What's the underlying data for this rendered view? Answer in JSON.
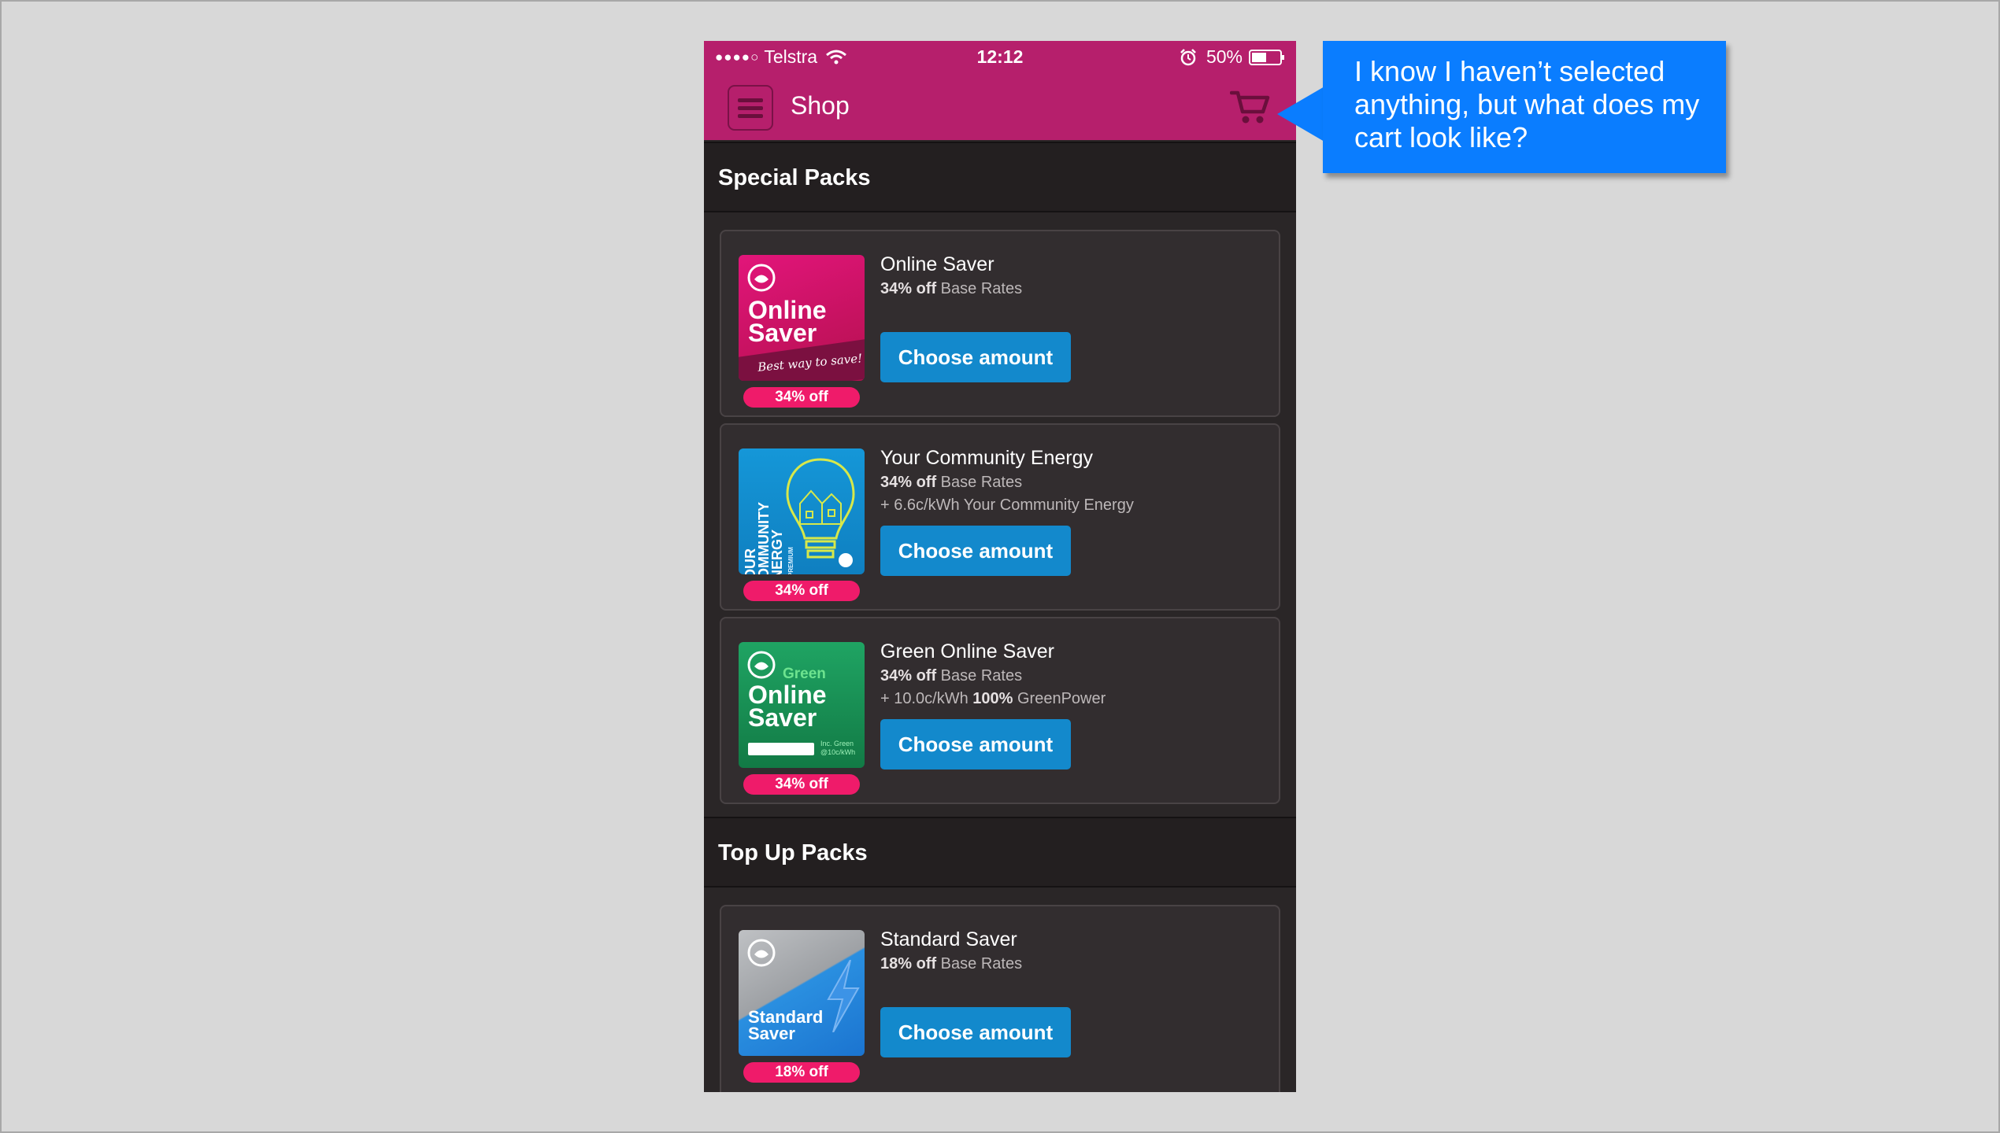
{
  "status_bar": {
    "signal": "●●●●○",
    "carrier": "Telstra",
    "time": "12:12",
    "battery": "50%"
  },
  "nav": {
    "title": "Shop"
  },
  "sections": [
    {
      "title": "Special Packs",
      "items": [
        {
          "name": "Online Saver",
          "discount": "34% off",
          "rate_suffix": " Base Rates",
          "button": "Choose amount",
          "badge": "34% off",
          "image_lines": [
            "Online",
            "Saver"
          ],
          "image_tagline": "Best way to save!"
        },
        {
          "name": "Your Community Energy",
          "discount": "34% off",
          "rate_suffix": " Base Rates",
          "extra": "+ 6.6c/kWh Your Community Energy",
          "button": "Choose amount",
          "badge": "34% off",
          "image_lines": [
            "YOUR",
            "COMMUNITY",
            "ENERGY"
          ],
          "image_tagline": "INC PREMIUM"
        },
        {
          "name": "Green Online Saver",
          "discount": "34% off",
          "rate_suffix": " Base Rates",
          "extra_prefix": "+ 10.0c/kWh ",
          "extra_bold": "100%",
          "extra_suffix": " GreenPower",
          "button": "Choose amount",
          "badge": "34% off",
          "image_lines": [
            "Green",
            "Online",
            "Saver"
          ],
          "image_tagline": "Inc. Green @10c/kWh"
        }
      ]
    },
    {
      "title": "Top Up Packs",
      "items": [
        {
          "name": "Standard Saver",
          "discount": "18% off",
          "rate_suffix": " Base Rates",
          "button": "Choose amount",
          "badge": "18% off",
          "image_lines": [
            "Standard",
            "Saver"
          ]
        }
      ]
    }
  ],
  "callout": {
    "text": "I know I haven’t selected anything, but what does my cart look like?"
  },
  "colors": {
    "brand_magenta": "#b61f6c",
    "button_blue": "#1389cc",
    "badge_pink": "#ef1b6a",
    "callout_blue": "#0a7dff"
  }
}
